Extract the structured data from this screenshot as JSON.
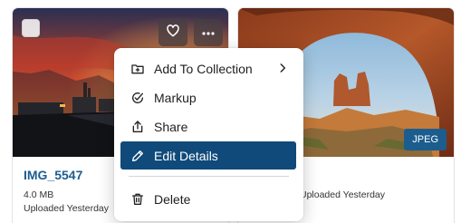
{
  "assets": [
    {
      "filename": "IMG_5547",
      "size": "4.0 MB",
      "uploaded": "Uploaded Yesterday",
      "thumbnail": "sunset-street-photo"
    },
    {
      "filename": "",
      "size": "",
      "uploaded": "Uploaded Yesterday",
      "type_badge": "JPEG",
      "thumbnail": "rock-arch-photo"
    }
  ],
  "card_actions": {
    "favorite_icon": "heart-icon",
    "more_icon": "ellipsis-icon"
  },
  "context_menu": {
    "items": [
      {
        "label": "Add To Collection",
        "icon": "folder-plus-icon",
        "has_submenu": true
      },
      {
        "label": "Markup",
        "icon": "check-circle-icon"
      },
      {
        "label": "Share",
        "icon": "share-icon"
      },
      {
        "label": "Edit Details",
        "icon": "pencil-icon",
        "highlighted": true
      },
      {
        "label": "Delete",
        "icon": "trash-icon"
      }
    ]
  },
  "colors": {
    "accent": "#1c5d8f",
    "menu_highlight": "#0f4a7a"
  }
}
